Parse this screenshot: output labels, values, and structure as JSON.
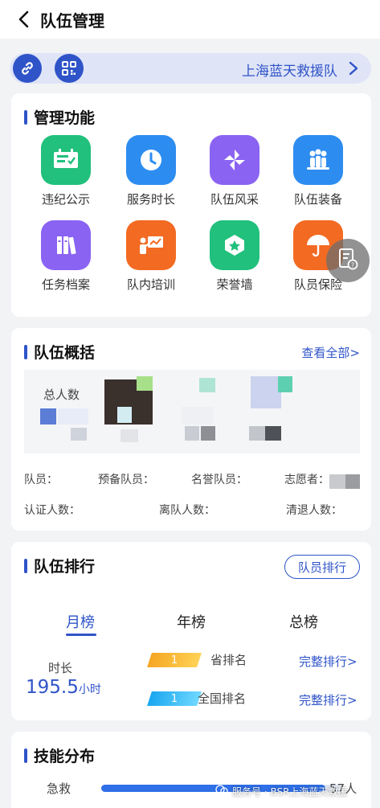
{
  "header": {
    "title": "队伍管理"
  },
  "team_bar": {
    "team_name": "上海蓝天救援队",
    "link_icon": "link-icon",
    "qr_icon": "qr-code-icon"
  },
  "management": {
    "title": "管理功能",
    "items": [
      {
        "label": "违纪公示",
        "icon": "notice-board-icon",
        "color": "#21c07c"
      },
      {
        "label": "服务时长",
        "icon": "clock-icon",
        "color": "#2d8cf0"
      },
      {
        "label": "队伍风采",
        "icon": "pinwheel-icon",
        "color": "#8a63f2"
      },
      {
        "label": "队伍装备",
        "icon": "team-people-icon",
        "color": "#2d8cf0"
      },
      {
        "label": "任务档案",
        "icon": "file-books-icon",
        "color": "#8a63f2"
      },
      {
        "label": "队内培训",
        "icon": "training-icon",
        "color": "#f36a22"
      },
      {
        "label": "荣誉墙",
        "icon": "honor-badge-icon",
        "color": "#21c07c"
      },
      {
        "label": "队员保险",
        "icon": "umbrella-icon",
        "color": "#f36a22"
      }
    ]
  },
  "overview": {
    "title": "队伍概括",
    "view_all": "查看全部>",
    "total_label": "总人数",
    "stats_row1": [
      "队员：",
      "预备队员：",
      "名誉队员：",
      "志愿者："
    ],
    "stats_row2": [
      "认证人数：",
      "离队人数：",
      "清退人数："
    ]
  },
  "ranking": {
    "title": "队伍排行",
    "member_rank_button": "队员排行",
    "tabs": [
      "月榜",
      "年榜",
      "总榜"
    ],
    "active_tab": "月榜",
    "duration_label": "时长",
    "duration_value": "195.5",
    "duration_unit": "小时",
    "rows": [
      {
        "rank": "1",
        "label": "省排名",
        "link": "完整排行>",
        "color_from": "#f5a623",
        "color_to": "#ffd256"
      },
      {
        "rank": "1",
        "label": "全国排名",
        "link": "完整排行>",
        "color_from": "#1aa6f0",
        "color_to": "#6fd8ff"
      }
    ]
  },
  "skills": {
    "title": "技能分布",
    "items": [
      {
        "label": "急救",
        "value": "57人",
        "fill": 0.93
      }
    ]
  },
  "watermark": {
    "text": "服务号 · BSR上海蓝天救援"
  },
  "colors": {
    "primary": "#2f54c8",
    "background": "#f2f3f5"
  }
}
